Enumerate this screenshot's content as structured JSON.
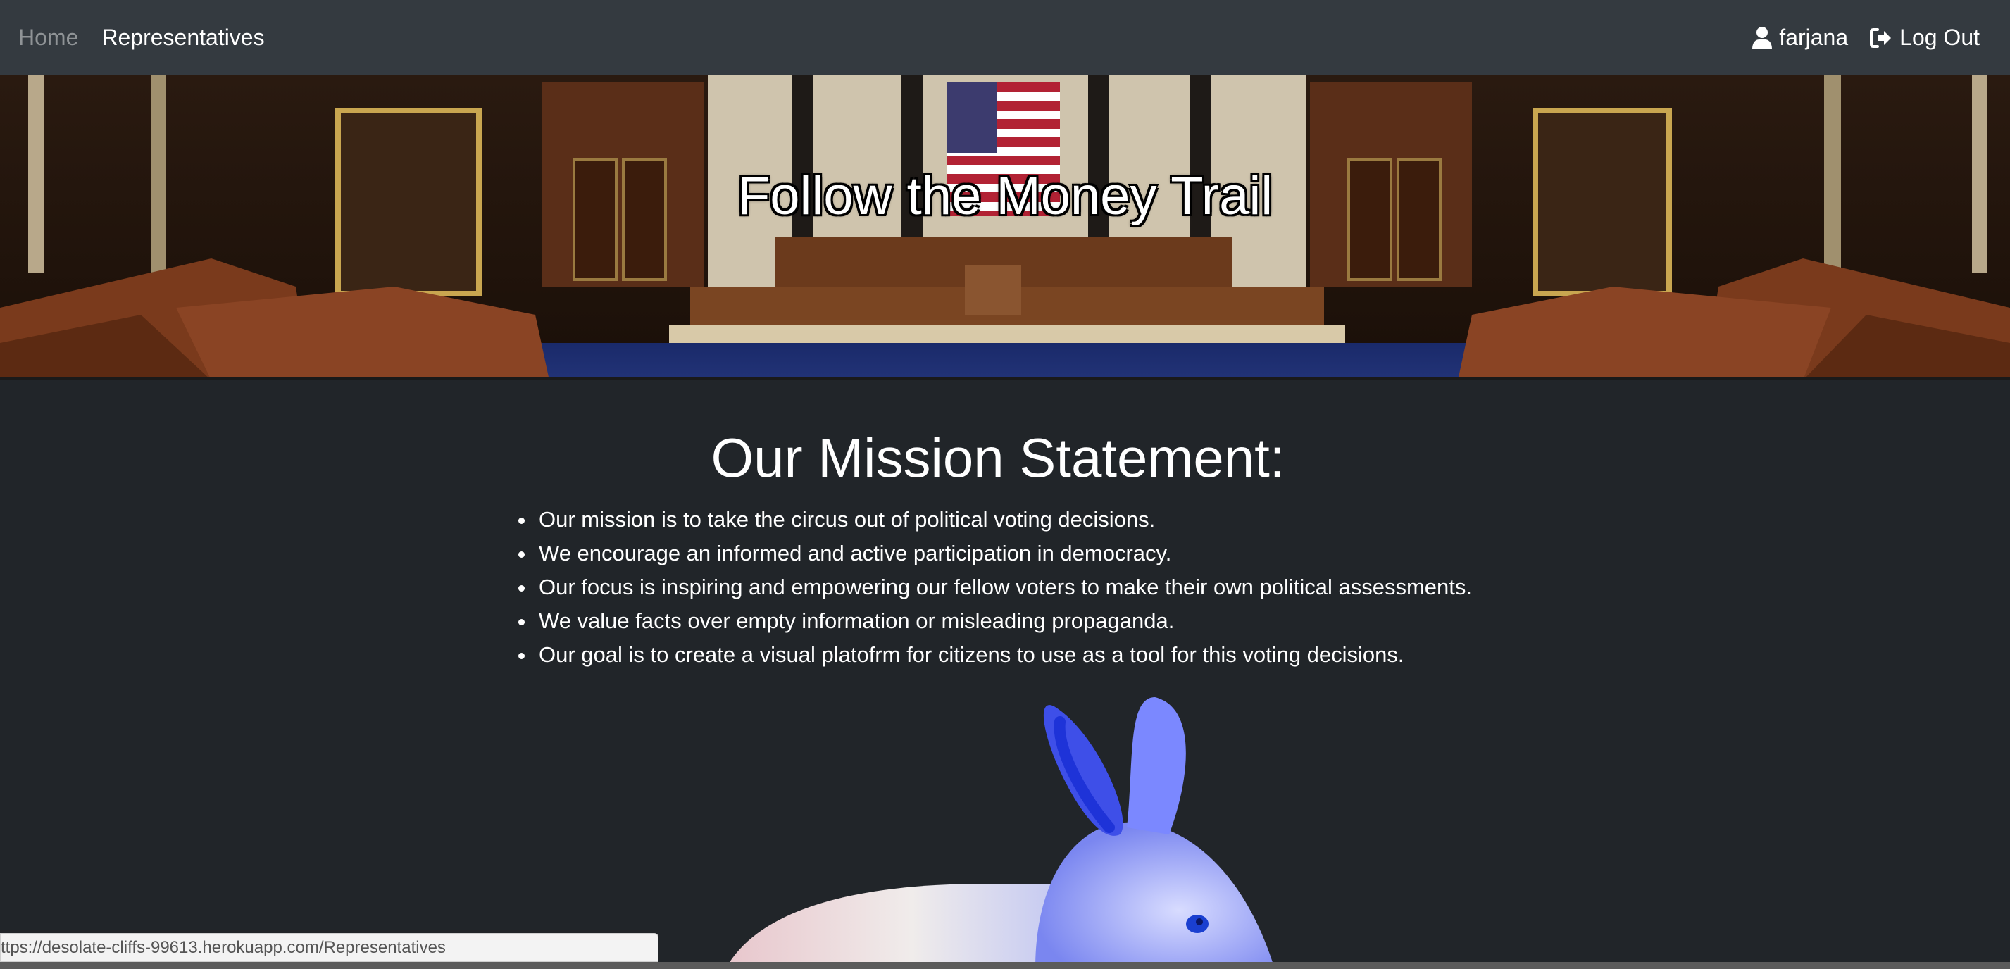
{
  "navbar": {
    "home_label": "Home",
    "representatives_label": "Representatives",
    "user_label": "farjana",
    "logout_label": "Log Out",
    "user_icon": "user-icon",
    "logout_icon": "sign-out-icon"
  },
  "hero": {
    "title": "Follow the Money Trail"
  },
  "mission": {
    "heading": "Our Mission Statement:",
    "items": [
      "Our mission is to take the circus out of political voting decisions.",
      "We encourage an informed and active participation in democracy.",
      "Our focus is inspiring and empowering our fellow voters to make their own political assessments.",
      "We value facts over empty information or misleading propaganda.",
      "Our goal is to create a visual platofrm for citizens to use as a tool for this voting decisions."
    ]
  },
  "status_bar": {
    "url": "ttps://desolate-cliffs-99613.herokuapp.com/Representatives"
  },
  "colors": {
    "navbar_bg": "#343a40",
    "page_bg": "#212529",
    "nav_muted": "#8f9396"
  }
}
